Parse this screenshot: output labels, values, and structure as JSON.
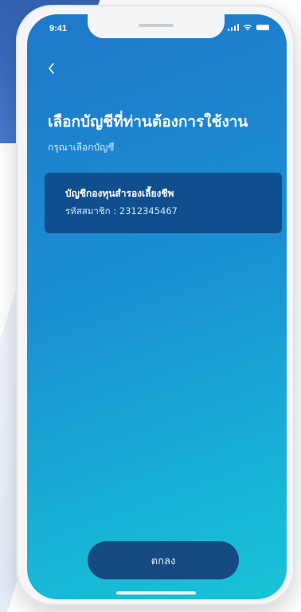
{
  "status_bar": {
    "time": "9:41"
  },
  "header": {
    "back_icon": "chevron-left-icon",
    "title": "เลือกบัญชีที่ท่านต้องการใช้งาน",
    "subtitle": "กรุณาเลือกบัญชี"
  },
  "accounts": [
    {
      "name": "บัญชีกองทุนสำรองเลี้ยงชีพ",
      "member_label": "รหัสสมาชิก : 2312345467"
    }
  ],
  "footer": {
    "confirm_label": "ตกลง"
  },
  "colors": {
    "screen_gradient_start": "#1f78c9",
    "screen_gradient_end": "#19c3d6",
    "card_background": "#0f4f8e",
    "button_background": "#154b81"
  }
}
